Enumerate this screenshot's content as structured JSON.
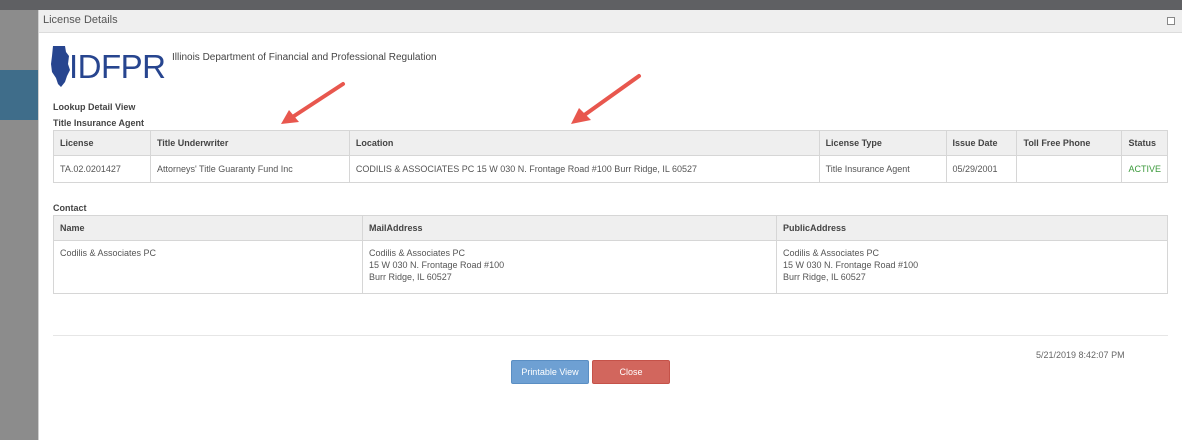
{
  "dialog": {
    "title": "License Details"
  },
  "header": {
    "logo_text": "IDFPR",
    "agency_name": "Illinois Department of Financial and Professional Regulation"
  },
  "lookup_title": "Lookup Detail View",
  "license_section": {
    "label": "Title Insurance Agent",
    "columns": [
      "License",
      "Title Underwriter",
      "Location",
      "License Type",
      "Issue Date",
      "Toll Free Phone",
      "Status"
    ],
    "rows": [
      [
        "TA.02.0201427",
        "Attorneys' Title Guaranty Fund Inc",
        "CODILIS & ASSOCIATES PC 15 W 030 N. Frontage Road #100 Burr Ridge, IL 60527",
        "Title Insurance Agent",
        "05/29/2001",
        "",
        "ACTIVE"
      ]
    ]
  },
  "contact_section": {
    "label": "Contact",
    "columns": [
      "Name",
      "MailAddress",
      "PublicAddress"
    ],
    "rows": [
      {
        "name": "Codilis & Associates PC",
        "mail": [
          "Codilis & Associates PC",
          "15 W 030 N. Frontage Road #100",
          "Burr Ridge, IL 60527"
        ],
        "public": [
          "Codilis & Associates PC",
          "15 W 030 N. Frontage Road #100",
          "Burr Ridge, IL 60527"
        ]
      }
    ]
  },
  "footer": {
    "timestamp": "5/21/2019 8:42:07 PM",
    "printable_label": "Printable View",
    "close_label": "Close"
  },
  "colors": {
    "brand_blue": "#27458f",
    "status_active": "#3c9a3c",
    "printable_button": "#6ea0d3",
    "close_button": "#d2665d",
    "annotation_arrow": "#e8574e"
  },
  "icons": [
    "maximize-icon",
    "illinois-state-logo-icon",
    "annotation-arrow-icon"
  ]
}
